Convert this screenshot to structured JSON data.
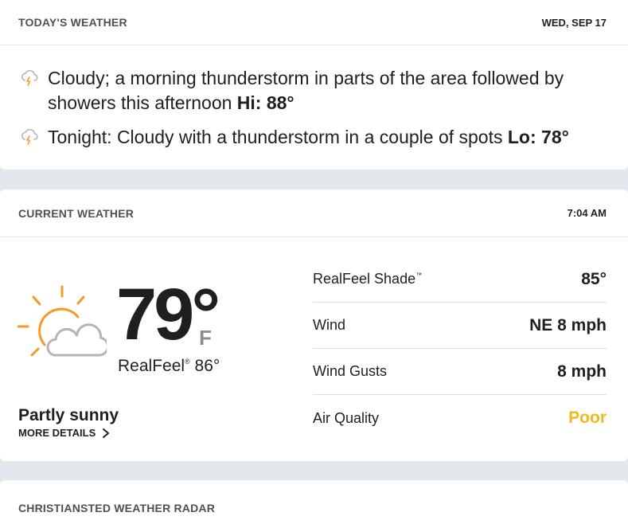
{
  "today": {
    "title": "TODAY'S WEATHER",
    "date": "WED, SEP 17",
    "forecasts": [
      {
        "icon": "thunderstorm-cloud-icon",
        "text": "Cloudy; a morning thunderstorm in parts of the area followed by showers this afternoon ",
        "hilo": "Hi: 88°"
      },
      {
        "icon": "thunderstorm-cloud-icon",
        "text": "Tonight: Cloudy with a thunderstorm in a couple of spots ",
        "hilo": "Lo: 78°"
      }
    ]
  },
  "current": {
    "title": "CURRENT WEATHER",
    "time": "7:04 AM",
    "icon": "partly-sunny-icon",
    "temp": "79°",
    "unit": "F",
    "realfeel_label": "RealFeel",
    "realfeel_mark": "®",
    "realfeel_value": "86°",
    "phrase": "Partly sunny",
    "more_details": "MORE DETAILS",
    "details": [
      {
        "label": "RealFeel Shade",
        "mark": "™",
        "value": "85°"
      },
      {
        "label": "Wind",
        "mark": "",
        "value": "NE 8 mph"
      },
      {
        "label": "Wind Gusts",
        "mark": "",
        "value": "8 mph"
      },
      {
        "label": "Air Quality",
        "mark": "",
        "value": "Poor",
        "value_color": "#f5b61e"
      }
    ]
  },
  "radar": {
    "title": "CHRISTIANSTED WEATHER RADAR"
  }
}
